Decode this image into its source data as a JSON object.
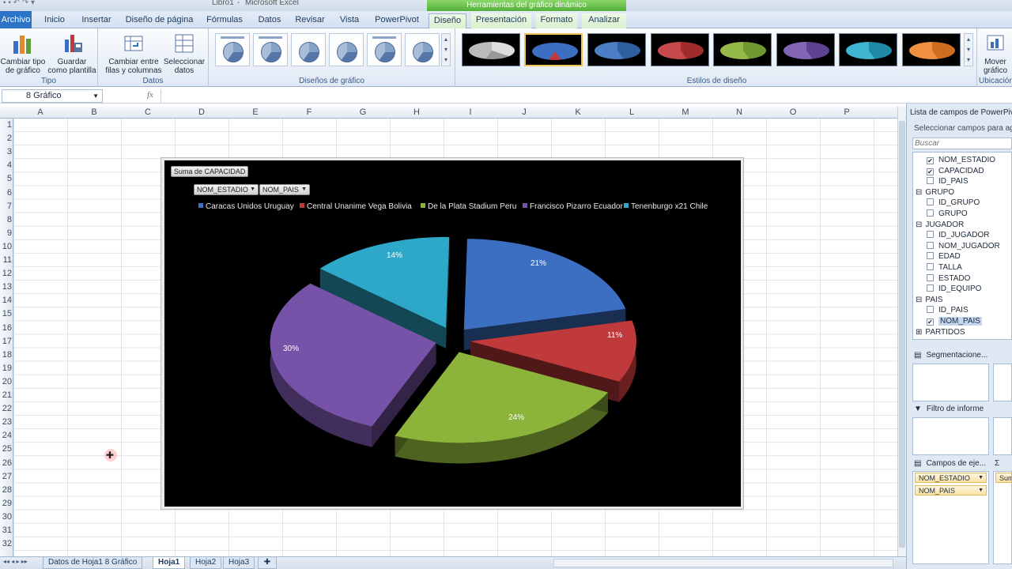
{
  "window": {
    "title_file": "Libro1",
    "title_app": "Microsoft Excel",
    "context_title": "Herramientas del gráfico dinámico"
  },
  "tabs": {
    "file": "Archivo",
    "items": [
      "Inicio",
      "Insertar",
      "Diseño de página",
      "Fórmulas",
      "Datos",
      "Revisar",
      "Vista",
      "PowerPivot"
    ],
    "context": [
      "Diseño",
      "Presentación",
      "Formato",
      "Analizar"
    ]
  },
  "ribbon": {
    "change_chart_type": "Cambiar tipo de gráfico",
    "save_template": "Guardar como plantilla",
    "group_type": "Tipo",
    "switch_rows_cols": "Cambiar entre filas y columnas",
    "select_data": "Seleccionar datos",
    "group_data": "Datos",
    "group_layouts": "Diseños de gráfico",
    "group_styles": "Estilos de diseño",
    "move_chart": "Mover gráfico",
    "group_location": "Ubicación"
  },
  "formula_bar": {
    "name_box": "8 Gráfico",
    "fx": "fx",
    "value": ""
  },
  "columns": [
    "A",
    "B",
    "C",
    "D",
    "E",
    "F",
    "G",
    "H",
    "I",
    "J",
    "K",
    "L",
    "M",
    "N",
    "O",
    "P"
  ],
  "rows": [
    "1",
    "2",
    "3",
    "4",
    "5",
    "6",
    "7",
    "8",
    "9",
    "10",
    "11",
    "12",
    "13",
    "14",
    "15",
    "16",
    "17",
    "18",
    "19",
    "20",
    "21",
    "22",
    "23",
    "24",
    "25",
    "26",
    "27",
    "28",
    "29",
    "30",
    "31",
    "32"
  ],
  "chart": {
    "value_field": "Suma de CAPACIDAD",
    "axis_fields": [
      "NOM_ESTADIO",
      "NOM_PAIS"
    ]
  },
  "chart_data": {
    "type": "pie",
    "title": "",
    "categories": [
      "Caracas Unidos Uruguay",
      "Central Unanime Vega Bolivia",
      "De la Plata Stadium Peru",
      "Francisco Pizarro Ecuador",
      "Tenenburgo x21 Chile"
    ],
    "values": [
      21,
      11,
      24,
      30,
      14
    ],
    "labels": [
      "21%",
      "11%",
      "24%",
      "30%",
      "14%"
    ],
    "colors": [
      "#3c6fc2",
      "#c0393b",
      "#8db43a",
      "#7653a8",
      "#2ea8c8"
    ],
    "legend": "top",
    "exploded": true
  },
  "sheets": {
    "tabs": [
      "Datos de Hoja1 8 Gráfico",
      "Hoja1",
      "Hoja2",
      "Hoja3"
    ],
    "active": "Hoja1"
  },
  "pivot_panel": {
    "title": "Lista de campos de PowerPivot",
    "subtitle": "Seleccionar campos para agregar",
    "search_placeholder": "Buscar",
    "fields": [
      {
        "label": "NOM_ESTADIO",
        "checked": true,
        "indent": 1
      },
      {
        "label": "CAPACIDAD",
        "checked": true,
        "indent": 1
      },
      {
        "label": "ID_PAIS",
        "checked": false,
        "indent": 1
      },
      {
        "label": "GRUPO",
        "table": true,
        "expanded": true
      },
      {
        "label": "ID_GRUPO",
        "checked": false,
        "indent": 1
      },
      {
        "label": "GRUPO",
        "checked": false,
        "indent": 1
      },
      {
        "label": "JUGADOR",
        "table": true,
        "expanded": true
      },
      {
        "label": "ID_JUGADOR",
        "checked": false,
        "indent": 1
      },
      {
        "label": "NOM_JUGADOR",
        "checked": false,
        "indent": 1
      },
      {
        "label": "EDAD",
        "checked": false,
        "indent": 1
      },
      {
        "label": "TALLA",
        "checked": false,
        "indent": 1
      },
      {
        "label": "ESTADO",
        "checked": false,
        "indent": 1
      },
      {
        "label": "ID_EQUIPO",
        "checked": false,
        "indent": 1
      },
      {
        "label": "PAIS",
        "table": true,
        "expanded": true
      },
      {
        "label": "ID_PAIS",
        "checked": false,
        "indent": 1
      },
      {
        "label": "NOM_PAIS",
        "checked": true,
        "indent": 1,
        "highlight": true
      },
      {
        "label": "PARTIDOS",
        "table": true,
        "expanded": false
      }
    ],
    "areas": {
      "slicers": "Segmentacione...",
      "filter": "Filtro de informe",
      "axis": "Campos de eje...",
      "axis_items": [
        "NOM_ESTADIO",
        "NOM_PAIS"
      ],
      "values_item": "Sum"
    }
  }
}
